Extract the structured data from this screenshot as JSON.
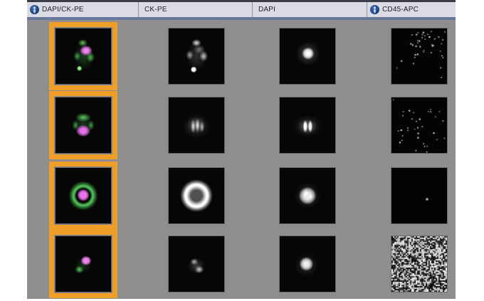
{
  "header": {
    "columns": [
      {
        "id": "dapi-ck-pe",
        "label": "DAPI/CK-PE",
        "has_icon": true
      },
      {
        "id": "ck-pe",
        "label": "CK-PE",
        "has_icon": false
      },
      {
        "id": "dapi",
        "label": "DAPI",
        "has_icon": false
      },
      {
        "id": "cd45-apc",
        "label": "CD45-APC",
        "has_icon": true
      }
    ]
  },
  "colors": {
    "selection_orange": "#EF9E27",
    "panel_gray": "#8E8E8E",
    "header_bg": "#DBDBE3",
    "header_topbar": "#3C3C46",
    "header_underline": "#68779B",
    "tile_black": "#060606",
    "icon_blue": "#16396F",
    "overlay_green": "#5CD964",
    "overlay_magenta": "#EE78EE"
  },
  "grid": {
    "rows": [
      {
        "cells": [
          {
            "channel": "DAPI/CK-PE",
            "selected": true,
            "visual": "overlay-oval-cell"
          },
          {
            "channel": "CK-PE",
            "selected": false,
            "visual": "ck-patchy-oval"
          },
          {
            "channel": "DAPI",
            "selected": false,
            "visual": "dapi-round-blob"
          },
          {
            "channel": "CD45-APC",
            "selected": false,
            "visual": "apc-speckles-upper"
          }
        ]
      },
      {
        "cells": [
          {
            "channel": "DAPI/CK-PE",
            "selected": true,
            "visual": "overlay-green-cap-cell"
          },
          {
            "channel": "CK-PE",
            "selected": false,
            "visual": "ck-striated-blob"
          },
          {
            "channel": "DAPI",
            "selected": false,
            "visual": "dapi-double-bar"
          },
          {
            "channel": "CD45-APC",
            "selected": false,
            "visual": "apc-speckles-scattered"
          }
        ]
      },
      {
        "cells": [
          {
            "channel": "DAPI/CK-PE",
            "selected": true,
            "visual": "overlay-ring-nucleus"
          },
          {
            "channel": "CK-PE",
            "selected": false,
            "visual": "ck-bright-ring"
          },
          {
            "channel": "DAPI",
            "selected": false,
            "visual": "dapi-bright-nucleus"
          },
          {
            "channel": "CD45-APC",
            "selected": false,
            "visual": "apc-single-dot"
          }
        ]
      },
      {
        "cells": [
          {
            "channel": "DAPI/CK-PE",
            "selected": true,
            "visual": "overlay-small-cell"
          },
          {
            "channel": "CK-PE",
            "selected": false,
            "visual": "ck-dim-two-lobe"
          },
          {
            "channel": "DAPI",
            "selected": false,
            "visual": "dapi-soft-blob"
          },
          {
            "channel": "CD45-APC",
            "selected": false,
            "visual": "apc-dense-noise"
          }
        ]
      }
    ]
  }
}
